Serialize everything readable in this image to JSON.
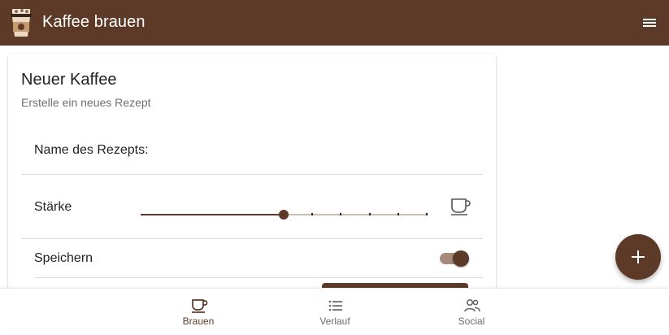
{
  "app_bar": {
    "title": "Kaffee brauen",
    "logo_icon": "coffee-cup-logo-icon",
    "menu_icon": "hamburger-menu-icon"
  },
  "card": {
    "title": "Neuer Kaffee",
    "subtitle": "Erstelle ein neues Rezept",
    "recipe_name": {
      "label": "Name des Rezepts:",
      "value": ""
    },
    "strength": {
      "label": "Stärke",
      "value_fraction": 0.5,
      "ticks": 5,
      "icon": "coffee-cup-icon"
    },
    "save": {
      "label": "Speichern",
      "checked": true
    }
  },
  "fab": {
    "icon": "plus-icon"
  },
  "bottom_nav": {
    "items": [
      {
        "label": "Brauen",
        "icon": "coffee-cup-icon",
        "active": true
      },
      {
        "label": "Verlauf",
        "icon": "list-icon",
        "active": false
      },
      {
        "label": "Social",
        "icon": "people-icon",
        "active": false
      }
    ]
  },
  "colors": {
    "primary": "#5d3a28",
    "toggle_track": "#a4897c",
    "slider_rest": "#cdbdb3"
  }
}
